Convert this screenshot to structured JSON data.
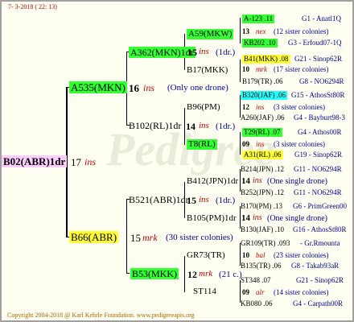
{
  "header": {
    "date": "7- 3-2018 ( 22: 13)"
  },
  "watermark": "Pedigree",
  "root": {
    "name": "B02(ABR)1dr",
    "num": "17",
    "tag": "ins"
  },
  "gen1": [
    {
      "name": "A535(MKN)",
      "num": "16",
      "tag": "ins",
      "note": "(Only one drone)"
    },
    {
      "name": "B66(ABR)",
      "num": "15",
      "tag": "mrk",
      "note": "(30 sister colonies)"
    }
  ],
  "gen2": [
    {
      "name": "A362(MKN)1dr",
      "num": "15",
      "tag": "ins",
      "note": "(1dr.)"
    },
    {
      "name": "B102(RL)1dr",
      "num": "14",
      "tag": "ins",
      "note": "(1dr.)"
    },
    {
      "name": "B521(ABR)1dr",
      "num": "15",
      "tag": "ins",
      "note": "(1dr.)"
    },
    {
      "name": "B53(MKK)",
      "num": "12",
      "tag": "mrk",
      "note": "(21 c.)"
    }
  ],
  "gen3": [
    {
      "name": "A59(MKW)"
    },
    {
      "name": "B17(MKK)"
    },
    {
      "name": "B96(PM)"
    },
    {
      "name": "T8(RL)"
    },
    {
      "name": "B412(JPN)1dr",
      "num": "14",
      "tag": "ins",
      "note": "(One single drone)"
    },
    {
      "name": "B105(PM)1dr",
      "num": "14",
      "tag": "ins",
      "note": "(One single drone)"
    },
    {
      "name": "GR73(TR)"
    },
    {
      "name": "ST114"
    }
  ],
  "gen4": [
    {
      "name": "A-123 .11",
      "id": "G1 - Anatl1Q"
    },
    {
      "num": "13",
      "tag": "nex",
      "note": "(12 sister colonies)"
    },
    {
      "name": "KB202 .10",
      "id": "G3 - Erfoud07-1Q"
    },
    {
      "name": "B41(MKK) .08",
      "id": "G21 - Sinop62R"
    },
    {
      "num": "10",
      "tag": "mrk",
      "note": "(17 sister colonies)"
    },
    {
      "name": "B179(TR) .06",
      "id": "G8 - NO6294R"
    },
    {
      "name": "B320(JAF) .06",
      "id": "G15 - AthosSt80R"
    },
    {
      "num": "12",
      "tag": "ins",
      "note": "(3 sister colonies)"
    },
    {
      "name": "A260(JAF) .06",
      "id": "G4 - Bayburt98-3"
    },
    {
      "name": "T29(RL) .07",
      "id": "G4 - Athos00R"
    },
    {
      "num": "09",
      "tag": "ins",
      "note": "(3 sister colonies)"
    },
    {
      "name": "A31(RL) .06",
      "id": "G19 - Sinop62R"
    },
    {
      "name": "B214(JPN) .12",
      "id": "G11 - NO6294R"
    },
    {
      "name": "B252(JPN) .12",
      "id": "G11 - NO6294R"
    },
    {
      "name": "B170(PM) .13",
      "id": "G6 - PrimGreen00"
    },
    {
      "name": "B130(JAF) .10",
      "id": "G16 - AthosSt80R"
    },
    {
      "name": "GR109(TR) .093",
      "id": "- Gr.Rmounta"
    },
    {
      "num": "10",
      "tag": "bal",
      "note": "(23 sister colonies)"
    },
    {
      "name": "B135(TR) .06",
      "id": "G8 - Takab93aR"
    },
    {
      "name": "ST348 .07",
      "id": "G21 - Sinop62R"
    },
    {
      "num": "09",
      "tag": "alr",
      "note": "(14 sister colonies)"
    },
    {
      "name": "KB080 .06",
      "id": "G4 - Carpath00R"
    }
  ],
  "footer": "Copyright 2004-2018 @ Karl Kehrle Foundation.   www.pedigreeapis.org",
  "colors": {
    "green": "#33ff33",
    "yellow": "#ffff33",
    "cyan": "#22ffff",
    "pink": "#ffccff",
    "accent": "#cc0000",
    "note": "#000099"
  }
}
